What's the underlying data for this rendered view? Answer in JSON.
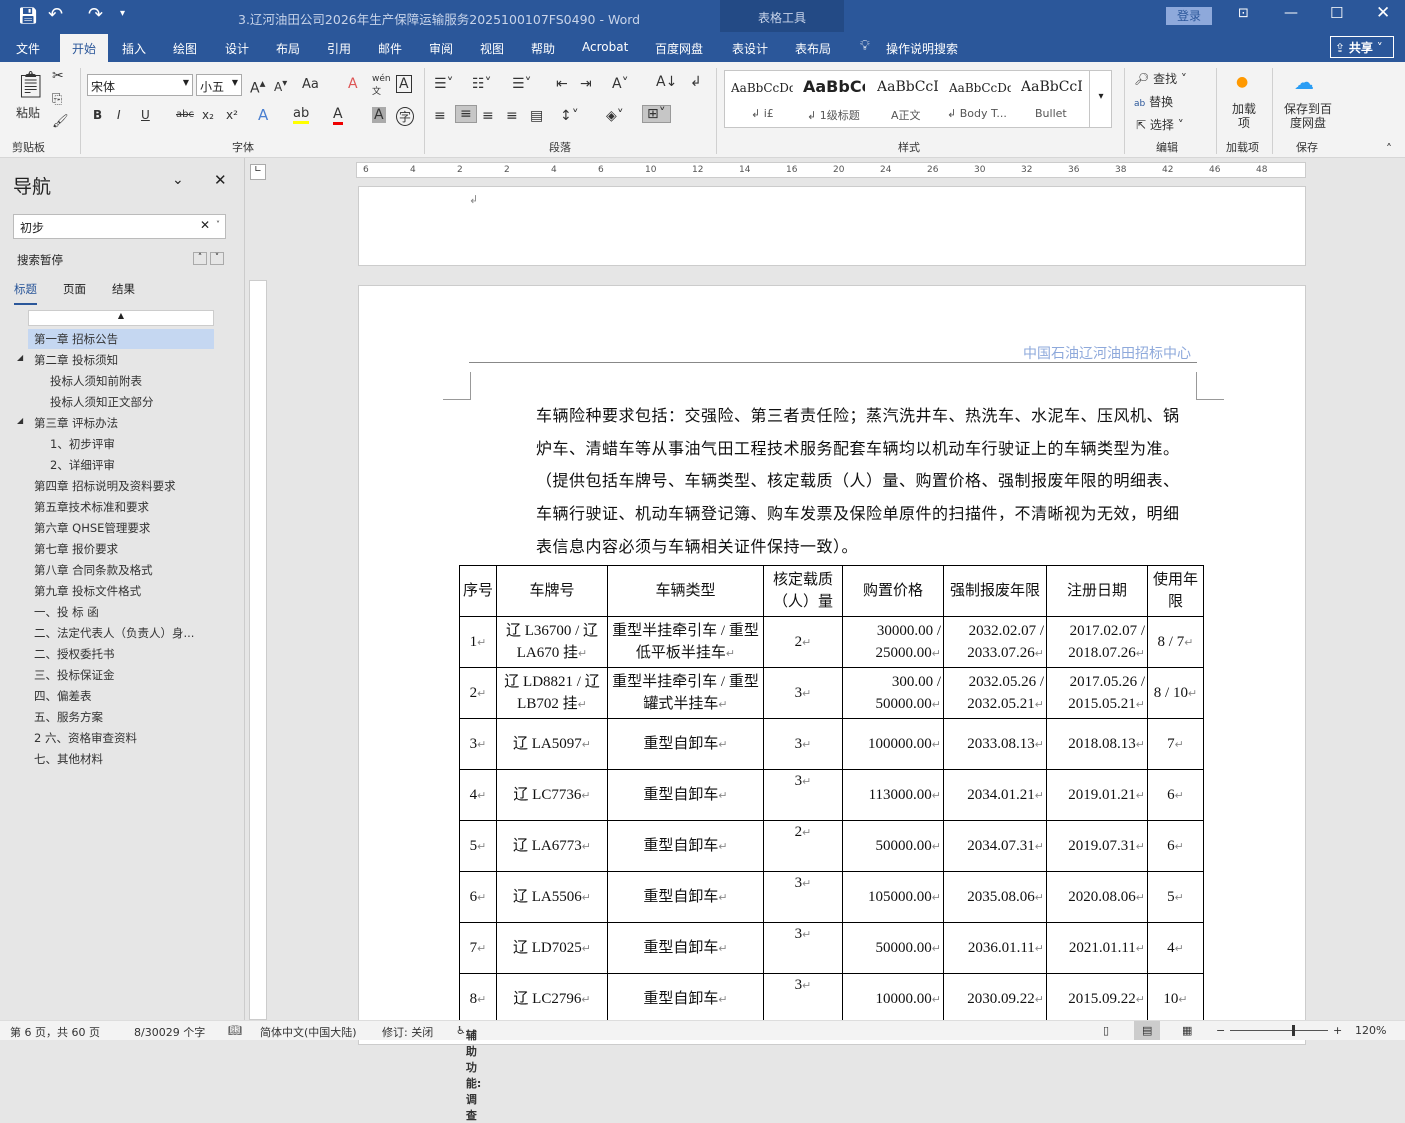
{
  "title_bar": {
    "doc_title": "3.辽河油田公司2026年生产保障运输服务2025100107FS0490  -  Word",
    "context_tab": "表格工具",
    "login": "登录",
    "qat": [
      "save-icon",
      "undo-icon",
      "redo-icon",
      "customize-icon"
    ]
  },
  "tabs": [
    "文件",
    "开始",
    "插入",
    "绘图",
    "设计",
    "布局",
    "引用",
    "邮件",
    "审阅",
    "视图",
    "帮助",
    "Acrobat",
    "百度网盘",
    "表设计",
    "表布局"
  ],
  "active_tab": "开始",
  "tell_me": "操作说明搜索",
  "share": "共享",
  "ribbon": {
    "clipboard": {
      "label": "剪贴板",
      "paste": "粘贴"
    },
    "font": {
      "label": "字体",
      "font_name": "宋体",
      "font_size": "小五",
      "aa": "Aa",
      "buttons": [
        "B",
        "I",
        "U",
        "abc",
        "x₂",
        "x²"
      ]
    },
    "paragraph": {
      "label": "段落"
    },
    "styles": {
      "label": "样式",
      "items": [
        {
          "preview": "AaBbCcDd",
          "name": "↲ i£"
        },
        {
          "preview": "AaBbCc",
          "name": "↲ 1级标题"
        },
        {
          "preview": "AaBbCcI",
          "name": "A正文"
        },
        {
          "preview": "AaBbCcDd",
          "name": "↲ Body T..."
        },
        {
          "preview": "AaBbCcI",
          "name": "Bullet"
        }
      ]
    },
    "editing": {
      "label": "编辑",
      "find": "查找",
      "replace": "替换",
      "select": "选择"
    },
    "addins": {
      "label": "加载项",
      "button": "加载项"
    },
    "save": {
      "label": "保存",
      "button": "保存到百度网盘"
    }
  },
  "nav": {
    "title": "导航",
    "search_value": "初步",
    "status": "搜索暂停",
    "tabs": [
      "标题",
      "页面",
      "结果"
    ],
    "active_tab": "标题",
    "items": [
      {
        "text": "第一章  招标公告",
        "level": 1,
        "selected": true
      },
      {
        "text": "第二章  投标须知",
        "level": 1,
        "expanded": true
      },
      {
        "text": "投标人须知前附表",
        "level": 2
      },
      {
        "text": "投标人须知正文部分",
        "level": 2
      },
      {
        "text": "第三章  评标办法",
        "level": 1,
        "expanded": true
      },
      {
        "text": "1、初步评审",
        "level": 2
      },
      {
        "text": "2、详细评审",
        "level": 2
      },
      {
        "text": "第四章  招标说明及资料要求",
        "level": 1
      },
      {
        "text": "第五章技术标准和要求",
        "level": 1
      },
      {
        "text": "第六章  QHSE管理要求",
        "level": 1
      },
      {
        "text": "第七章  报价要求",
        "level": 1
      },
      {
        "text": "第八章  合同条款及格式",
        "level": 1
      },
      {
        "text": "第九章  投标文件格式",
        "level": 1
      },
      {
        "text": "一、投 标 函",
        "level": 1
      },
      {
        "text": "二、法定代表人（负责人）身...",
        "level": 1
      },
      {
        "text": "二、授权委托书",
        "level": 1
      },
      {
        "text": "三、投标保证金",
        "level": 1
      },
      {
        "text": "四、偏差表",
        "level": 1
      },
      {
        "text": "五、服务方案",
        "level": 1
      },
      {
        "text": "2 六、资格审查资料",
        "level": 1
      },
      {
        "text": "七、其他材料",
        "level": 1
      }
    ]
  },
  "ruler": {
    "labels": [
      "6",
      "4",
      "2",
      "2",
      "4",
      "6",
      "10",
      "12",
      "14",
      "16",
      "20",
      "24",
      "26",
      "30",
      "32",
      "36",
      "38",
      "42",
      "46",
      "48"
    ]
  },
  "document": {
    "header_text": "中国石油辽河油田招标中心",
    "paragraph_lines": [
      "车辆险种要求包括：交强险、第三者责任险；蒸汽洗井车、热洗车、水泥车、压风机、锅",
      "炉车、清蜡车等从事油气田工程技术服务配套车辆均以机动车行驶证上的车辆类型为准。",
      "（提供包括车牌号、车辆类型、核定载质（人）量、购置价格、强制报废年限的明细表、",
      "车辆行驶证、机动车辆登记簿、购车发票及保险单原件的扫描件，不清晰视为无效，明细",
      "表信息内容必须与车辆相关证件保持一致）。"
    ],
    "table": {
      "headers": [
        "序号",
        "车牌号",
        "车辆类型",
        "核定载质（人）量",
        "购置价格",
        "强制报废年限",
        "注册日期",
        "使用年限"
      ],
      "rows": [
        [
          "1",
          "辽 L36700 / 辽 LA670 挂",
          "重型半挂牵引车 / 重型低平板半挂车",
          "2",
          "30000.00 / 25000.00",
          "2032.02.07 / 2033.07.26",
          "2017.02.07 / 2018.07.26",
          "8 / 7"
        ],
        [
          "2",
          "辽 LD8821 / 辽 LB702 挂",
          "重型半挂牵引车 / 重型罐式半挂车",
          "3",
          "300.00 / 50000.00",
          "2032.05.26 / 2032.05.21",
          "2017.05.26 / 2015.05.21",
          "8 / 10"
        ],
        [
          "3",
          "辽 LA5097",
          "重型自卸车",
          "3",
          "100000.00",
          "2033.08.13",
          "2018.08.13",
          "7"
        ],
        [
          "4",
          "辽 LC7736",
          "重型自卸车",
          "3",
          "113000.00",
          "2034.01.21",
          "2019.01.21",
          "6"
        ],
        [
          "5",
          "辽 LA6773",
          "重型自卸车",
          "2",
          "50000.00",
          "2034.07.31",
          "2019.07.31",
          "6"
        ],
        [
          "6",
          "辽 LA5506",
          "重型自卸车",
          "3",
          "105000.00",
          "2035.08.06",
          "2020.08.06",
          "5"
        ],
        [
          "7",
          "辽 LD7025",
          "重型自卸车",
          "3",
          "50000.00",
          "2036.01.11",
          "2021.01.11",
          "4"
        ],
        [
          "8",
          "辽 LC2796",
          "重型自卸车",
          "3",
          "10000.00",
          "2030.09.22",
          "2015.09.22",
          "10"
        ]
      ]
    }
  },
  "status": {
    "page": "第 6 页，共 60 页",
    "words": "8/30029 个字",
    "language": "简体中文(中国大陆)",
    "track": "修订: 关闭",
    "accessibility": "辅助功能: 调查",
    "zoom": "120%",
    "zoom_level": 120
  },
  "colors": {
    "brand": "#2b579a",
    "header_text": "#8ea9db",
    "selected_nav": "#c5d7f1"
  }
}
